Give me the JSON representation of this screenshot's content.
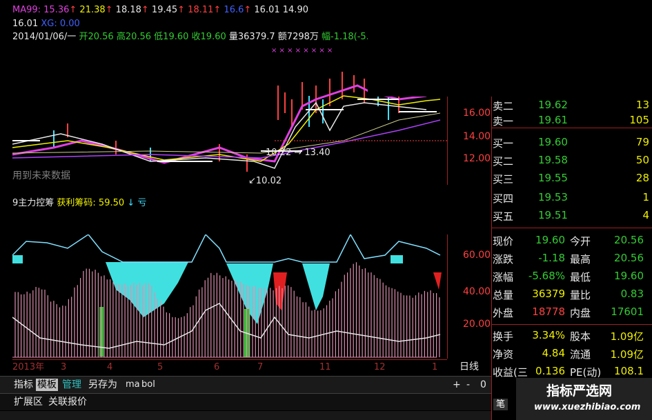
{
  "indicator_header": {
    "ma99": "MA99: 15.36",
    "v2": "21.38",
    "v3": "18.18",
    "v4": "19.45",
    "v5": "18.11",
    "v6": "16.6",
    "v7": "16.01",
    "v8": "14.90",
    "row2_a": "16.01",
    "row2_b": "XG: 0.00"
  },
  "ohlc_bar": {
    "date": "2014/01/06/一",
    "open": "开20.56",
    "high": "高20.56",
    "low": "低19.60",
    "close": "收19.60",
    "volume": "量36379.7",
    "amount": "额7298万",
    "change": "幅-1.18(-5.6"
  },
  "price_axis": [
    "16.00",
    "14.00",
    "12.00"
  ],
  "price_annotations": {
    "low_mark": "10.02",
    "mid_mark": "13.40",
    "mid_mark_prefix": "10.22"
  },
  "watermark_future": "用到未来数据",
  "sub_indicator": {
    "name": "9主力控筹",
    "profit_label": "获利筹码: 59.50",
    "loss_label": "亏"
  },
  "sub_axis": [
    "60.00",
    "40.00",
    "20.00"
  ],
  "time_axis": {
    "labels": [
      "2013年",
      "3",
      "4",
      "5",
      "6",
      "7",
      "11",
      "12",
      "1"
    ],
    "period": "日线"
  },
  "tabs": [
    "指标",
    "模板",
    "管理",
    "另存为",
    "ma",
    "bol"
  ],
  "tab_controls": [
    "+",
    "-",
    "0"
  ],
  "bottom_tabs": [
    "扩展区",
    "关联报价"
  ],
  "order_book": [
    {
      "label": "卖二",
      "price": "19.62",
      "vol": "13"
    },
    {
      "label": "卖一",
      "price": "19.61",
      "vol": "105"
    },
    {
      "label": "买一",
      "price": "19.60",
      "vol": "79"
    },
    {
      "label": "买二",
      "price": "19.58",
      "vol": "50"
    },
    {
      "label": "买三",
      "price": "19.55",
      "vol": "28"
    },
    {
      "label": "买四",
      "price": "19.53",
      "vol": "1"
    },
    {
      "label": "买五",
      "price": "19.51",
      "vol": "4"
    }
  ],
  "quote_stats": [
    {
      "l1": "现价",
      "v1": "19.60",
      "l2": "今开",
      "v2": "20.56"
    },
    {
      "l1": "涨跌",
      "v1": "-1.18",
      "l2": "最高",
      "v2": "20.56"
    },
    {
      "l1": "涨幅",
      "v1": "-5.68%",
      "l2": "最低",
      "v2": "19.60"
    },
    {
      "l1": "总量",
      "v1": "36379",
      "l2": "量比",
      "v2": "0.83"
    },
    {
      "l1": "外盘",
      "v1": "18778",
      "l2": "内盘",
      "v2": "17601"
    }
  ],
  "fund_stats": [
    {
      "l1": "换手",
      "v1": "3.34%",
      "l2": "股本",
      "v2": "1.09亿"
    },
    {
      "l1": "净资",
      "v1": "4.84",
      "l2": "流通",
      "v2": "1.09亿"
    },
    {
      "l1": "收益(三",
      "v1": "0.136",
      "l2": "PE(动)",
      "v2": "108.1"
    }
  ],
  "side_tab": "笔",
  "brand": {
    "name": "指标严选网",
    "url": "www.xuezhibiao.com"
  }
}
